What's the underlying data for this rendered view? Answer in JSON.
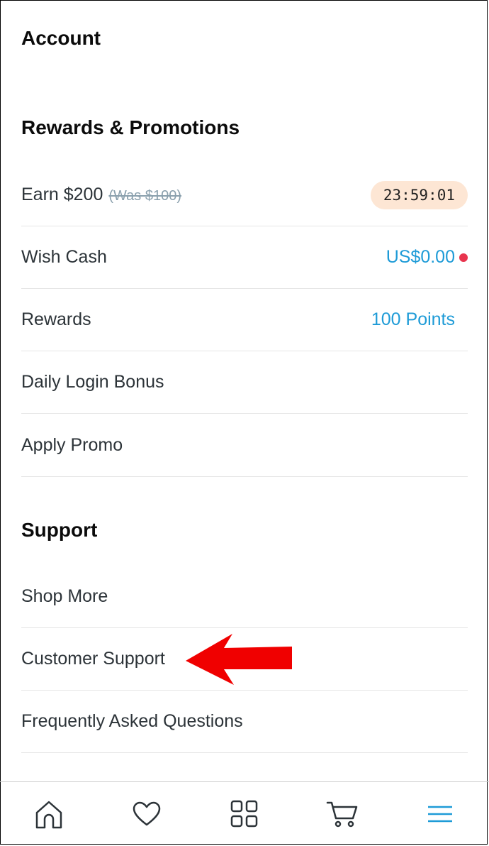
{
  "header": {
    "title": "Account"
  },
  "rewards_section": {
    "title": "Rewards & Promotions",
    "items": [
      {
        "label": "Earn $200",
        "strike": "(Was $100)",
        "timer": "23:59:01"
      },
      {
        "label": "Wish Cash",
        "value": "US$0.00"
      },
      {
        "label": "Rewards",
        "value": "100 Points"
      },
      {
        "label": "Daily Login Bonus"
      },
      {
        "label": "Apply Promo"
      }
    ]
  },
  "support_section": {
    "title": "Support",
    "items": [
      {
        "label": "Shop More"
      },
      {
        "label": "Customer Support"
      },
      {
        "label": "Frequently Asked Questions"
      }
    ]
  },
  "bottom_nav": {
    "items": [
      "home-icon",
      "heart-icon",
      "grid-icon",
      "cart-icon",
      "menu-icon"
    ],
    "active_color": "#1e9bd7"
  },
  "colors": {
    "accent": "#1e9bd7",
    "badge_bg": "#fde6d4",
    "dot": "#e8344e",
    "arrow": "#f00000"
  }
}
